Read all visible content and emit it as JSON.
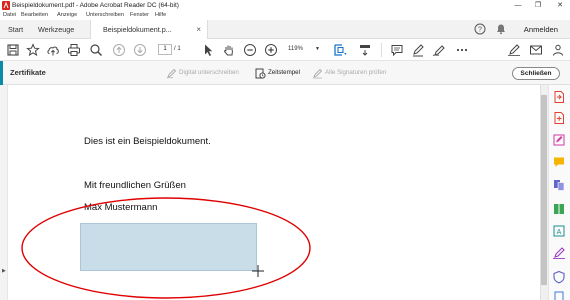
{
  "window": {
    "title": "Beispieldokument.pdf - Adobe Acrobat Reader DC (64-bit)",
    "minimize": "—",
    "maximize": "❐",
    "close": "✕"
  },
  "menu": [
    "Datei",
    "Bearbeiten",
    "Anzeige",
    "Unterschreiben",
    "Fenster",
    "Hilfe"
  ],
  "tabs": {
    "home": "Start",
    "tools": "Werkzeuge",
    "document": "Beispieldokument.p...",
    "document_close": "×"
  },
  "header": {
    "sign_in": "Anmelden"
  },
  "toolbar": {
    "page_current": "1",
    "page_total": "/ 1",
    "zoom": "119%"
  },
  "certificates": {
    "title": "Zertifikate",
    "digital_sign": "Digital unterschreiben",
    "timestamp": "Zeitstempel",
    "validate_all": "Alle Signaturen prüfen",
    "close": "Schließen"
  },
  "document": {
    "line1": "Dies ist ein Beispieldokument.",
    "line2": "Mit freundlichen Grüßen",
    "line3": "Max Mustermann"
  },
  "colors": {
    "accent": "#0a8aa6",
    "signature_field": "#c9dde9",
    "annotation": "#e00000"
  }
}
